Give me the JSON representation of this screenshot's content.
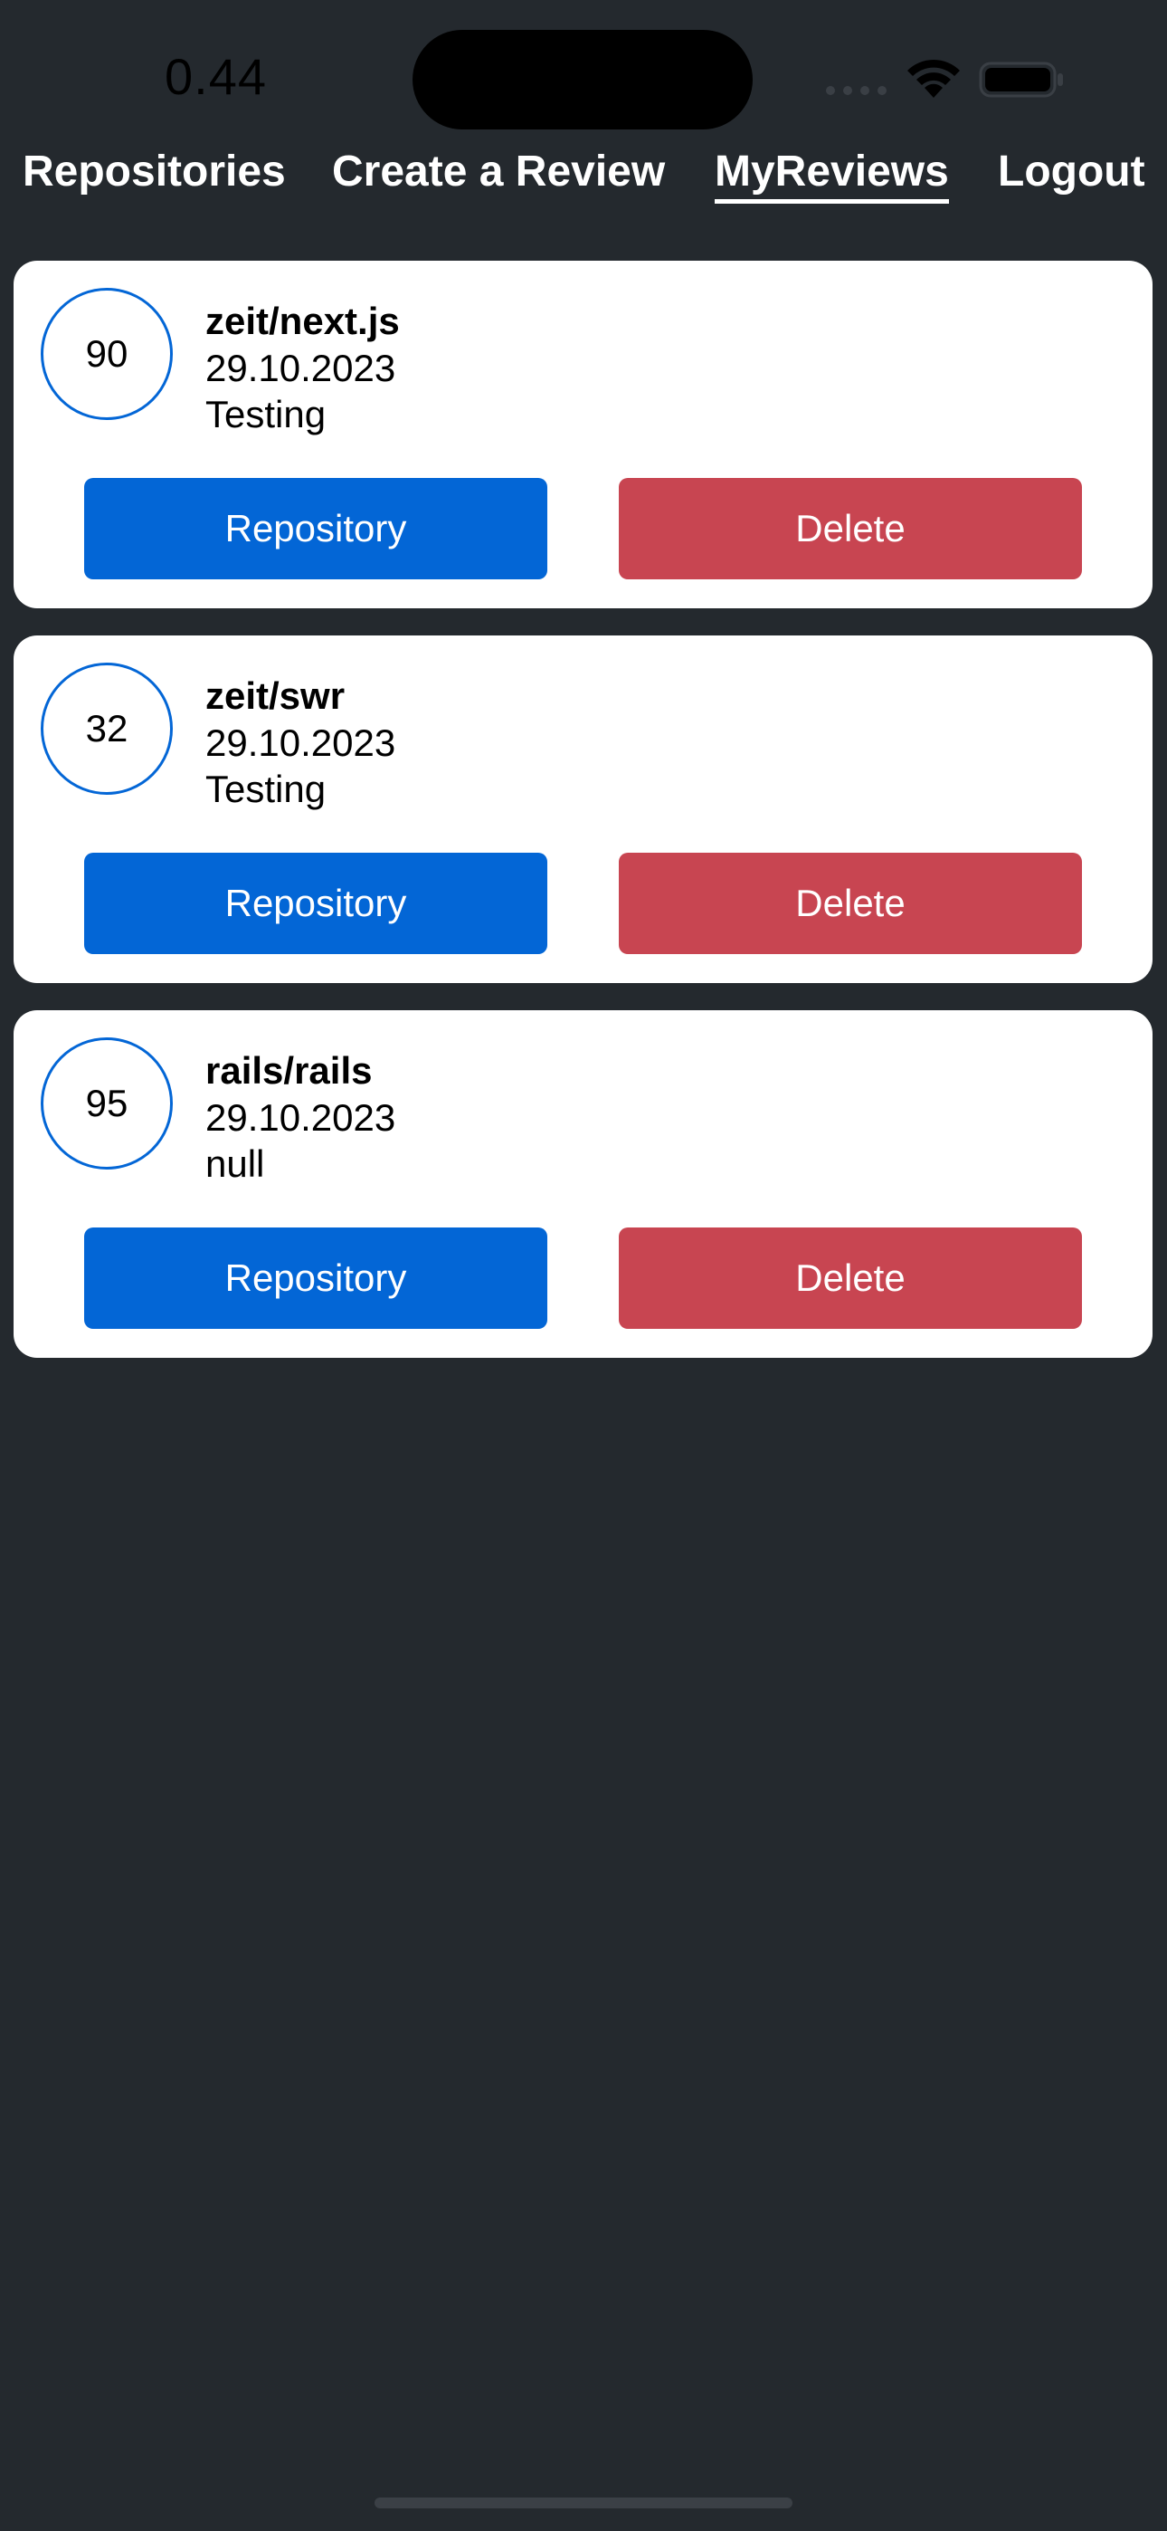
{
  "status_bar": {
    "time": "0.44",
    "icons": [
      "signal-icon",
      "wifi-icon",
      "battery-icon"
    ]
  },
  "nav": {
    "items": [
      {
        "label": "Repositories"
      },
      {
        "label": "Create a Review"
      },
      {
        "label": "MyReviews",
        "active": true
      },
      {
        "label": "Logout"
      }
    ]
  },
  "reviews": [
    {
      "rating": "90",
      "repo": "zeit/next.js",
      "date": "29.10.2023",
      "text": "Testing",
      "repository_label": "Repository",
      "delete_label": "Delete"
    },
    {
      "rating": "32",
      "repo": "zeit/swr",
      "date": "29.10.2023",
      "text": "Testing",
      "repository_label": "Repository",
      "delete_label": "Delete"
    },
    {
      "rating": "95",
      "repo": "rails/rails",
      "date": "29.10.2023",
      "text": "null",
      "repository_label": "Repository",
      "delete_label": "Delete"
    }
  ],
  "colors": {
    "background": "#24292e",
    "primary": "#0366d6",
    "danger": "#c84551",
    "card": "#ffffff"
  }
}
